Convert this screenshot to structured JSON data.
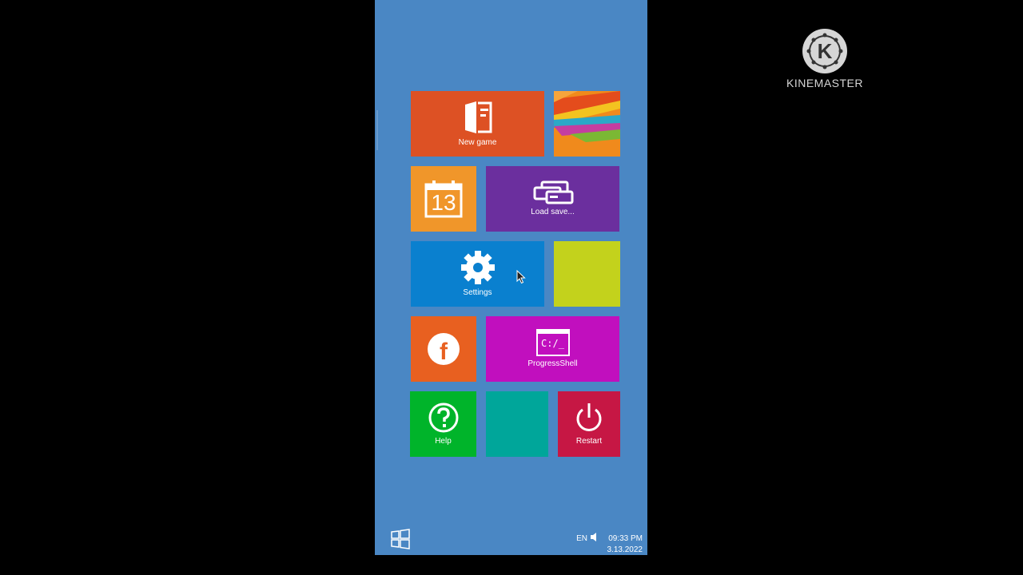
{
  "tiles": {
    "new_game": {
      "label": "New game",
      "color": "#dd5124"
    },
    "photos": {
      "color": "#f08a1c"
    },
    "calendar": {
      "day": "13",
      "color": "#f0962a"
    },
    "load_save": {
      "label": "Load save...",
      "color": "#6b2f9e"
    },
    "settings": {
      "label": "Settings",
      "color": "#0a80cf"
    },
    "lime": {
      "color": "#c3d21c"
    },
    "facebook": {
      "letter": "f",
      "color": "#e86020"
    },
    "progressshell": {
      "label": "ProgressShell",
      "prompt": "C:/_",
      "color": "#c10fbe"
    },
    "help": {
      "label": "Help",
      "color": "#00b42a"
    },
    "teal": {
      "color": "#00a69a"
    },
    "restart": {
      "label": "Restart",
      "color": "#c61744"
    }
  },
  "taskbar": {
    "language": "EN",
    "time": "09:33 PM",
    "date": "3.13.2022"
  },
  "watermark": {
    "logo_letter": "K",
    "text": "KINEMASTER"
  },
  "colors": {
    "background": "#000000",
    "desktop": "#4a87c4"
  }
}
